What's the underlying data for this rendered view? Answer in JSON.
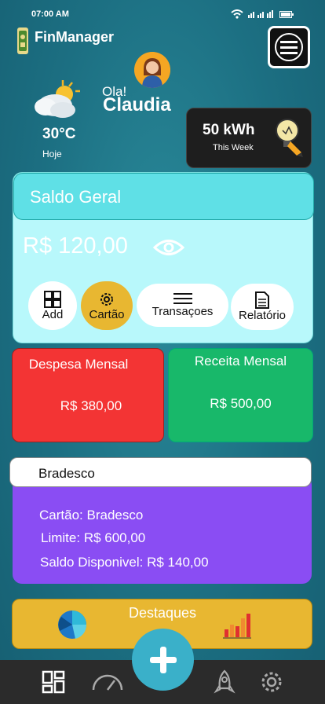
{
  "status": {
    "time": "07:00 AM"
  },
  "app": {
    "title": "FinManager"
  },
  "user": {
    "greeting": "Ola!",
    "name": "Claudia"
  },
  "weather": {
    "temperature": "30°C",
    "day": "Hoje",
    "icon": "partly-cloudy-icon"
  },
  "energy": {
    "value": "50 kWh",
    "period": "This Week",
    "icon": "lightbulb-icon"
  },
  "balance": {
    "title": "Saldo Geral",
    "amount": "R$ 120,00",
    "actions": [
      {
        "label": "Add",
        "icon": "grid-plus-icon"
      },
      {
        "label": "Cartão",
        "icon": "gear-icon"
      },
      {
        "label": "Transaçoes",
        "icon": "list-icon"
      },
      {
        "label": "Relatório",
        "icon": "document-icon"
      }
    ]
  },
  "expense": {
    "title": "Despesa Mensal",
    "value": "R$ 380,00"
  },
  "revenue": {
    "title": "Receita Mensal",
    "value": "R$ 500,00"
  },
  "bank": {
    "name": "Bradesco",
    "card_label": "Cartão:",
    "card_value": "Bradesco",
    "limit_label": "Limite:",
    "limit_value": "R$ 600,00",
    "available_label": "Saldo Disponivel:",
    "available_value": "R$ 140,00"
  },
  "highlights": {
    "title": "Destaques"
  },
  "colors": {
    "background": "#1c6f82",
    "balance_header": "#5fe0e6",
    "balance_body": "#b8f8fb",
    "expense": "#f33434",
    "revenue": "#18b86a",
    "bank": "#8a4df3",
    "highlight": "#e8b731",
    "fab": "#3ab0c9",
    "nav": "#2b2b2b"
  },
  "nav": {
    "items": [
      "dashboard-icon",
      "speedometer-icon",
      "rocket-icon",
      "settings-icon"
    ]
  }
}
